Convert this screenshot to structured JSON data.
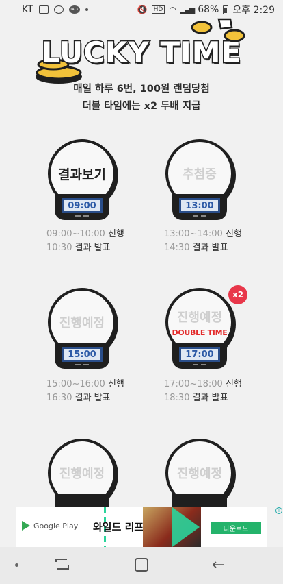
{
  "status_bar": {
    "carrier": "KT",
    "battery": "68%",
    "time": "오후 2:29",
    "icons": [
      "image-icon",
      "people-icon",
      "talk-icon",
      "mute-icon",
      "hd-icon",
      "wifi-icon",
      "signal-icon",
      "battery-icon"
    ]
  },
  "header": {
    "title": "LUCKY TIME",
    "subtitle_line1": "매일 하루 6번, 100원 랜덤당첨",
    "subtitle_line2": "더블 타임에는 x2 두배 지급"
  },
  "slots": [
    {
      "label": "결과보기",
      "time": "09:00",
      "progress": "09:00~10:00",
      "progress_label": "진행",
      "result": "10:30",
      "result_label": "결과 발표",
      "active": true
    },
    {
      "label": "추첨중",
      "time": "13:00",
      "progress": "13:00~14:00",
      "progress_label": "진행",
      "result": "14:30",
      "result_label": "결과 발표"
    },
    {
      "label": "진행예정",
      "time": "15:00",
      "progress": "15:00~16:00",
      "progress_label": "진행",
      "result": "16:30",
      "result_label": "결과 발표"
    },
    {
      "label": "진행예정",
      "double": "DOUBLE TIME",
      "badge": "x2",
      "time": "17:00",
      "progress": "17:00~18:00",
      "progress_label": "진행",
      "result": "18:30",
      "result_label": "결과 발표"
    },
    {
      "label": "진행예정"
    },
    {
      "label": "진행예정"
    }
  ],
  "ad": {
    "store": "Google Play",
    "title": "와일드 리프트",
    "button": "다운로드",
    "info": "i"
  },
  "colors": {
    "background": "#f1f1f1",
    "screen_text": "#2c5aa6",
    "badge": "#e8374a",
    "double_time": "#e32b2b",
    "ad_button": "#24b36b"
  }
}
